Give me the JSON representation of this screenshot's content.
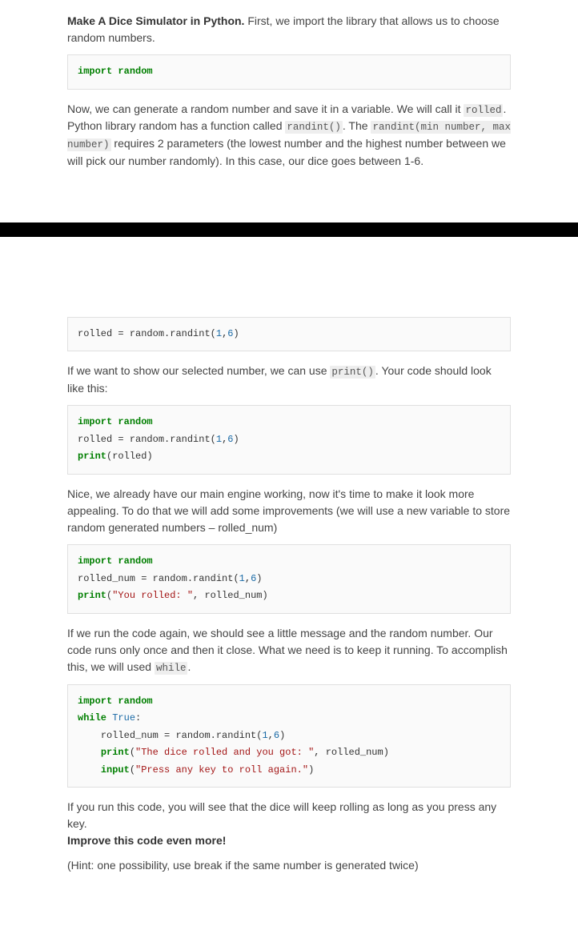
{
  "section1": {
    "intro": {
      "bold": "Make A Dice Simulator in Python.",
      "rest": " First, we import the library that allows us to choose random numbers."
    },
    "code1": {
      "kw_import": "import",
      "mod": "random"
    },
    "para2_a": "Now, we can generate a random number and save it in a variable. We will call it ",
    "para2_code1": "rolled",
    "para2_b": ". Python library  random has a function called ",
    "para2_code2": "randint()",
    "para2_c": ". The ",
    "para2_code3": "randint(min number, max number)",
    "para2_d": " requires 2 parameters (the lowest number and the highest number between we will pick our number randomly). In this case, our dice goes between 1-6."
  },
  "section2": {
    "code2_line": "rolled = random.randint(1,6)",
    "code2": {
      "id1": "rolled",
      "eq": " = ",
      "call": "random.randint",
      "open": "(",
      "n1": "1",
      "comma": ",",
      "n2": "6",
      "close": ")"
    },
    "para3_a": "If we want to show our selected number, we can use ",
    "para3_code1": "print()",
    "para3_b": ". Your code should look like this:",
    "code3": {
      "l1_kw": "import",
      "l1_mod": "random",
      "l2_id": "rolled",
      "l2_eq": " = ",
      "l2_call": "random.randint",
      "l2_open": "(",
      "l2_n1": "1",
      "l2_comma": ",",
      "l2_n2": "6",
      "l2_close": ")",
      "l3_fn": "print",
      "l3_open": "(",
      "l3_arg": "rolled",
      "l3_close": ")"
    },
    "para4": "Nice, we already have our main engine working, now it's time to make it look more appealing. To do that we will add some improvements (we will use a new variable to store random generated numbers – rolled_num)",
    "code4": {
      "l1_kw": "import",
      "l1_mod": "random",
      "l2_id": "rolled_num",
      "l2_eq": " = ",
      "l2_call": "random.randint",
      "l2_open": "(",
      "l2_n1": "1",
      "l2_comma": ",",
      "l2_n2": "6",
      "l2_close": ")",
      "l3_fn": "print",
      "l3_open": "(",
      "l3_str": "\"You rolled: \"",
      "l3_comma": ", ",
      "l3_arg": "rolled_num",
      "l3_close": ")"
    },
    "para5_a": "If we run the code again, we should see a little message and the random number. Our code runs only once and then it close. What we need is to keep it running. To accomplish this, we will used ",
    "para5_code1": "while",
    "para5_b": ".",
    "code5": {
      "l1_kw": "import",
      "l1_mod": "random",
      "l2_kw": "while",
      "l2_bool": "True",
      "l2_colon": ":",
      "indent": "    ",
      "l3_id": "rolled_num",
      "l3_eq": " = ",
      "l3_call": "random.randint",
      "l3_open": "(",
      "l3_n1": "1",
      "l3_comma": ",",
      "l3_n2": "6",
      "l3_close": ")",
      "l4_fn": "print",
      "l4_open": "(",
      "l4_str": "\"The dice rolled and you got: \"",
      "l4_comma": ", ",
      "l4_arg": "rolled_num",
      "l4_close": ")",
      "l5_fn": "input",
      "l5_open": "(",
      "l5_str": "\"Press any key to roll again.\"",
      "l5_close": ")"
    },
    "para6": "If you run this code, you will see that the dice will keep rolling as long as you press any key.",
    "para6_bold": "Improve this code even more!",
    "para7": "(Hint: one possibility, use break if the same number is generated twice)"
  }
}
